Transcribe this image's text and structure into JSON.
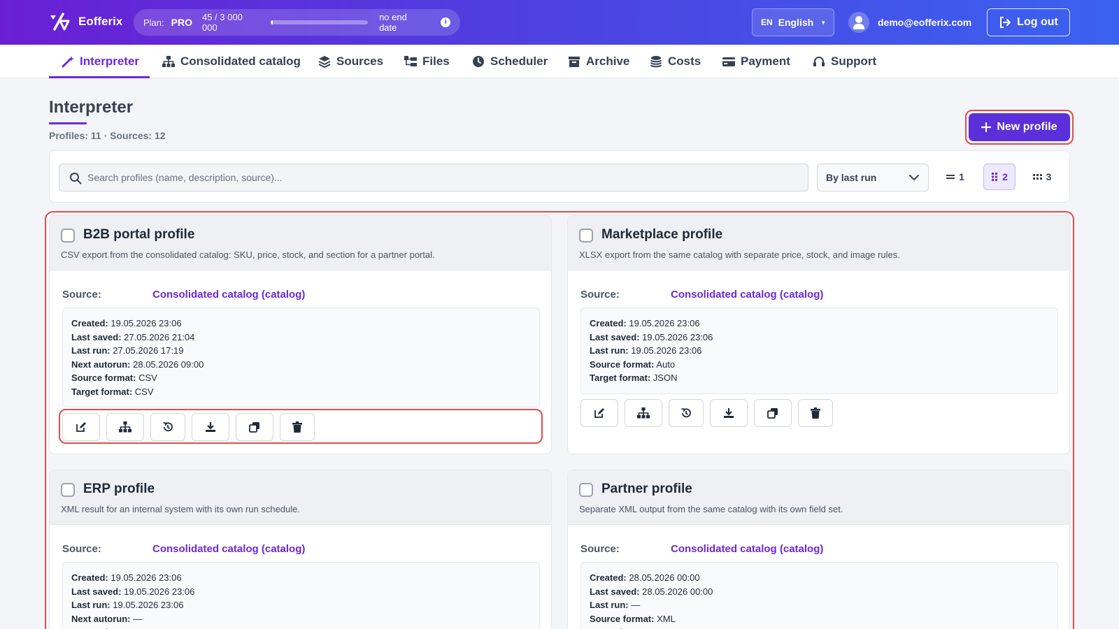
{
  "app": {
    "name": "Eofferix"
  },
  "plan": {
    "label": "Plan:",
    "tier": "PRO",
    "usage": "45 / 3 000 000",
    "usage_fraction": 1.5e-05,
    "end": "no end date"
  },
  "language": {
    "code": "EN",
    "name": "English"
  },
  "user": {
    "email": "demo@eofferix.com"
  },
  "logout_label": "Log out",
  "nav": [
    {
      "label": "Interpreter",
      "icon": "wand-icon",
      "active": true
    },
    {
      "label": "Consolidated catalog",
      "icon": "sitemap-icon"
    },
    {
      "label": "Sources",
      "icon": "layers-icon"
    },
    {
      "label": "Files",
      "icon": "folder-tree-icon"
    },
    {
      "label": "Scheduler",
      "icon": "clock-icon"
    },
    {
      "label": "Archive",
      "icon": "archive-icon"
    },
    {
      "label": "Costs",
      "icon": "coins-icon"
    },
    {
      "label": "Payment",
      "icon": "credit-card-icon"
    },
    {
      "label": "Support",
      "icon": "headset-icon"
    }
  ],
  "page": {
    "title": "Interpreter",
    "counts": "Profiles: 11 · Sources: 12",
    "new_profile": "New profile"
  },
  "toolbar": {
    "search_placeholder": "Search profiles (name, description, source)...",
    "sort": "By last run",
    "columns": [
      {
        "label": "1"
      },
      {
        "label": "2",
        "active": true
      },
      {
        "label": "3"
      }
    ]
  },
  "profiles": [
    {
      "title": "B2B portal profile",
      "desc": "CSV export from the consolidated catalog: SKU, price, stock, and section for a partner portal.",
      "source_label": "Source:",
      "source": "Consolidated catalog (catalog)",
      "meta": [
        {
          "k": "Created:",
          "v": "19.05.2026 23:06"
        },
        {
          "k": "Last saved:",
          "v": "27.05.2026 21:04"
        },
        {
          "k": "Last run:",
          "v": "27.05.2026 17:19"
        },
        {
          "k": "Next autorun:",
          "v": "28.05.2026 09:00"
        },
        {
          "k": "Source format:",
          "v": "CSV"
        },
        {
          "k": "Target format:",
          "v": "CSV"
        }
      ]
    },
    {
      "title": "Marketplace profile",
      "desc": "XLSX export from the same catalog with separate price, stock, and image rules.",
      "source_label": "Source:",
      "source": "Consolidated catalog (catalog)",
      "meta": [
        {
          "k": "Created:",
          "v": "19.05.2026 23:06"
        },
        {
          "k": "Last saved:",
          "v": "19.05.2026 23:06"
        },
        {
          "k": "Last run:",
          "v": "19.05.2026 23:06"
        },
        {
          "k": "Source format:",
          "v": "Auto"
        },
        {
          "k": "Target format:",
          "v": "JSON"
        }
      ]
    },
    {
      "title": "ERP profile",
      "desc": "XML result for an internal system with its own run schedule.",
      "source_label": "Source:",
      "source": "Consolidated catalog (catalog)",
      "meta": [
        {
          "k": "Created:",
          "v": "19.05.2026 23:06"
        },
        {
          "k": "Last saved:",
          "v": "19.05.2026 23:06"
        },
        {
          "k": "Last run:",
          "v": "19.05.2026 23:06"
        },
        {
          "k": "Next autorun:",
          "v": "—"
        },
        {
          "k": "Source format:",
          "v": "Auto"
        }
      ]
    },
    {
      "title": "Partner profile",
      "desc": "Separate XML output from the same catalog with its own field set.",
      "source_label": "Source:",
      "source": "Consolidated catalog (catalog)",
      "meta": [
        {
          "k": "Created:",
          "v": "28.05.2026 00:00"
        },
        {
          "k": "Last saved:",
          "v": "28.05.2026 00:00"
        },
        {
          "k": "Last run:",
          "v": "—"
        },
        {
          "k": "Source format:",
          "v": "XML"
        },
        {
          "k": "Target format:",
          "v": "XML"
        }
      ]
    }
  ],
  "actions": [
    {
      "icon": "edit-icon"
    },
    {
      "icon": "sitemap-icon"
    },
    {
      "icon": "history-icon"
    },
    {
      "icon": "download-icon"
    },
    {
      "icon": "copy-icon"
    },
    {
      "icon": "trash-icon"
    }
  ]
}
